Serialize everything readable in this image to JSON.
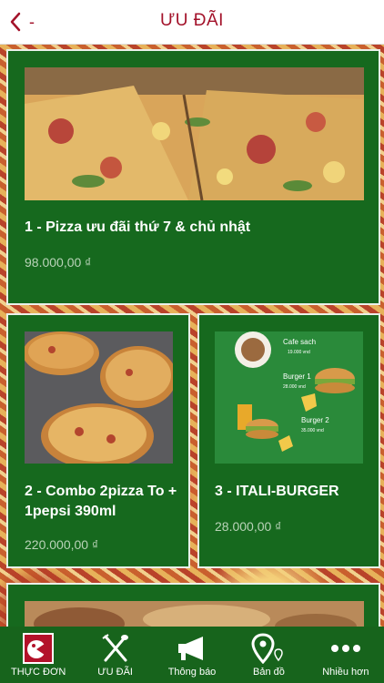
{
  "header": {
    "back_label": "-",
    "title": "ƯU ĐÃI"
  },
  "promotions": [
    {
      "name": "1 - Pizza ưu đãi thứ 7 & chủ nhật",
      "price": "98.000,00 ₫"
    },
    {
      "name": "2 - Combo 2pizza To + 1pepsi 390ml",
      "price": "220.000,00 ₫"
    },
    {
      "name": "3 - ITALI-BURGER",
      "price": "28.000,00 ₫"
    }
  ],
  "burger_poster": {
    "line1": "Cafe sach",
    "line1_price": "19.000 vnd",
    "line2": "Burger 1",
    "line2_price": "28.000 vnd",
    "line3": "Burger 2",
    "line3_price": "35.000 vnd"
  },
  "tabbar": [
    {
      "label": "THỰC ĐƠN",
      "icon": "menu-logo-icon"
    },
    {
      "label": "ƯU ĐÃI",
      "icon": "utensils-icon"
    },
    {
      "label": "Thông báo",
      "icon": "megaphone-icon"
    },
    {
      "label": "Bản đồ",
      "icon": "map-pin-icon"
    },
    {
      "label": "Nhiều hơn",
      "icon": "more-dots-icon"
    }
  ],
  "colors": {
    "brand_red": "#a3122a",
    "card_green": "#16691e",
    "tab_green": "#17641c"
  }
}
